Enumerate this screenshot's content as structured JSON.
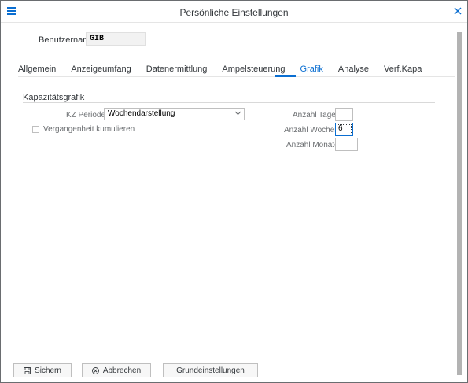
{
  "window": {
    "title": "Persönliche Einstellungen"
  },
  "icons": {
    "menu": "menu-icon",
    "close": "close-icon",
    "save": "save-icon",
    "cancel": "cancel-icon",
    "dropdown": "chevron-down-icon"
  },
  "user": {
    "label": "Benutzername:",
    "value": "GIB"
  },
  "tabs": [
    {
      "label": "Allgemein",
      "active": false
    },
    {
      "label": "Anzeigeumfang",
      "active": false
    },
    {
      "label": "Datenermittlung",
      "active": false
    },
    {
      "label": "Ampelsteuerung",
      "active": false
    },
    {
      "label": "Grafik",
      "active": true
    },
    {
      "label": "Analyse",
      "active": false
    },
    {
      "label": "Verf.Kapa",
      "active": false
    }
  ],
  "section": {
    "title": "Kapazitätsgrafik"
  },
  "form": {
    "period_label": "KZ Periode:",
    "period_value": "Wochendarstellung",
    "checkbox_label": "Vergangenheit kumulieren",
    "checkbox_checked": false,
    "days_label": "Anzahl Tage:",
    "days_value": "",
    "weeks_label": "Anzahl Wochen:",
    "weeks_value": "6",
    "months_label": "Anzahl Monate:",
    "months_value": ""
  },
  "footer": {
    "save_label": "Sichern",
    "cancel_label": "Abbrechen",
    "defaults_label": "Grundeinstellungen"
  },
  "colors": {
    "accent": "#0a6ed1",
    "text": "#32363a",
    "scrollbar": "#b3b3b3"
  }
}
